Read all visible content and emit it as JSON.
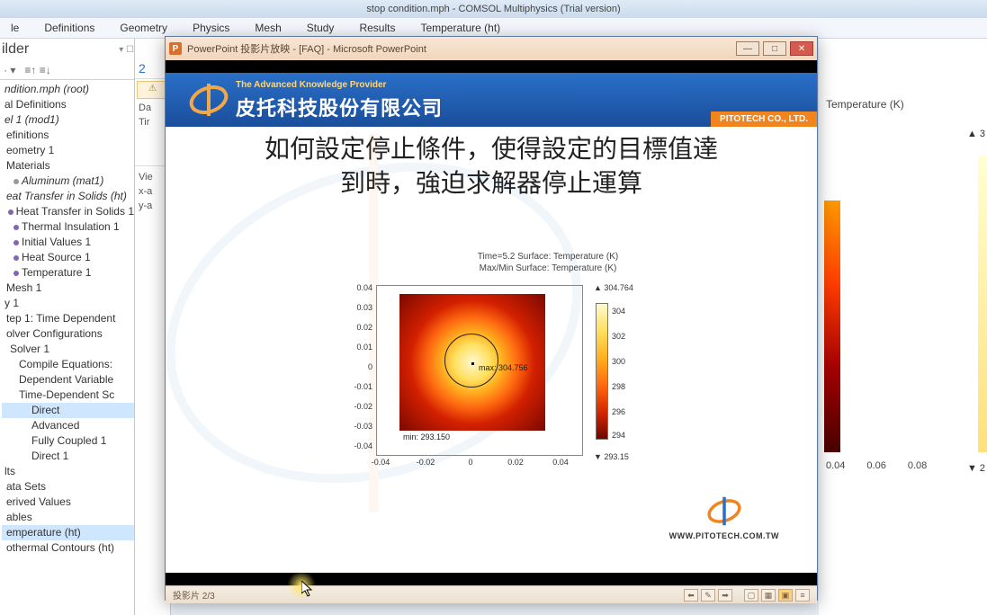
{
  "comsol": {
    "title": "stop condition.mph - COMSOL Multiphysics (Trial version)",
    "menus": [
      "le",
      "Definitions",
      "Geometry",
      "Physics",
      "Mesh",
      "Study",
      "Results",
      "Temperature (ht)"
    ],
    "builder_label": "ilder",
    "tree": [
      {
        "t": "ndition.mph  (root)",
        "i": 0,
        "sty": "italic"
      },
      {
        "t": "al Definitions",
        "i": 0
      },
      {
        "t": "el 1 (mod1)",
        "i": 0,
        "sty": "italic"
      },
      {
        "t": "efinitions",
        "i": 2
      },
      {
        "t": "eometry 1",
        "i": 2
      },
      {
        "t": "Materials",
        "i": 2
      },
      {
        "t": "Aluminum (mat1)",
        "i": 10,
        "sty": "italic",
        "b": "gray"
      },
      {
        "t": "eat Transfer in Solids (ht)",
        "i": 2,
        "sty": "italic"
      },
      {
        "t": "Heat Transfer in Solids 1",
        "i": 10,
        "b": "purple"
      },
      {
        "t": "Thermal Insulation 1",
        "i": 10,
        "b": "purple"
      },
      {
        "t": "Initial Values 1",
        "i": 10,
        "b": "purple"
      },
      {
        "t": "Heat Source 1",
        "i": 10,
        "b": "purple"
      },
      {
        "t": "Temperature 1",
        "i": 10,
        "b": "purple"
      },
      {
        "t": "Mesh 1",
        "i": 2
      },
      {
        "t": "y 1",
        "i": 0
      },
      {
        "t": "tep 1: Time Dependent",
        "i": 2
      },
      {
        "t": "olver Configurations",
        "i": 2
      },
      {
        "t": "Solver 1",
        "i": 6
      },
      {
        "t": "Compile Equations:",
        "i": 16
      },
      {
        "t": "Dependent Variable",
        "i": 16
      },
      {
        "t": "Time-Dependent Sc",
        "i": 16
      },
      {
        "t": "Direct",
        "i": 30,
        "sel": true
      },
      {
        "t": "Advanced",
        "i": 30
      },
      {
        "t": "Fully Coupled 1",
        "i": 30
      },
      {
        "t": "Direct 1",
        "i": 30
      },
      {
        "t": "lts",
        "i": 0
      },
      {
        "t": "ata Sets",
        "i": 2
      },
      {
        "t": "erived Values",
        "i": 2
      },
      {
        "t": "ables",
        "i": 2
      },
      {
        "t": "emperature (ht)",
        "i": 2,
        "sel": true
      },
      {
        "t": "othermal Contours (ht)",
        "i": 2
      }
    ],
    "mid_labels": [
      "Da",
      "Tir",
      "Vie",
      "x-a",
      "y-a"
    ],
    "right_plot": {
      "title": "Temperature (K)",
      "tri_up": "▲ 3",
      "tri_dn": "▼ 2",
      "xticks": [
        "0.04",
        "0.06",
        "0.08"
      ]
    }
  },
  "powerpoint": {
    "window_title": "PowerPoint 投影片放映 - [FAQ] - Microsoft PowerPoint",
    "provider": "The Advanced Knowledge Provider",
    "company_cn": "皮托科技股份有限公司",
    "company_tag": "PITOTECH CO., LTD.",
    "slide_title_l1": "如何設定停止條件，使得設定的目標值達",
    "slide_title_l2": "到時，強迫求解器停止運算",
    "status": "投影片 2/3",
    "footer_url": "WWW.PITOTECH.COM.TW"
  },
  "chart_data": {
    "type": "heatmap",
    "title": "Time=5.2   Surface: Temperature (K)",
    "subtitle": "Max/Min Surface: Temperature (K)",
    "xlabel": "",
    "ylabel": "",
    "xlim": [
      -0.04,
      0.04
    ],
    "ylim": [
      -0.04,
      0.04
    ],
    "xticks": [
      -0.04,
      -0.02,
      0,
      0.02,
      0.04
    ],
    "yticks": [
      -0.04,
      -0.03,
      -0.02,
      -0.01,
      0,
      0.01,
      0.02,
      0.03,
      0.04
    ],
    "colorbar": {
      "ticks": [
        294,
        296,
        298,
        300,
        302,
        304
      ],
      "max_marker": "▲ 304.764",
      "min_marker": "▼ 293.15"
    },
    "annotations": {
      "max_label": "max: 304.756",
      "min_label": "min: 293.150"
    }
  }
}
